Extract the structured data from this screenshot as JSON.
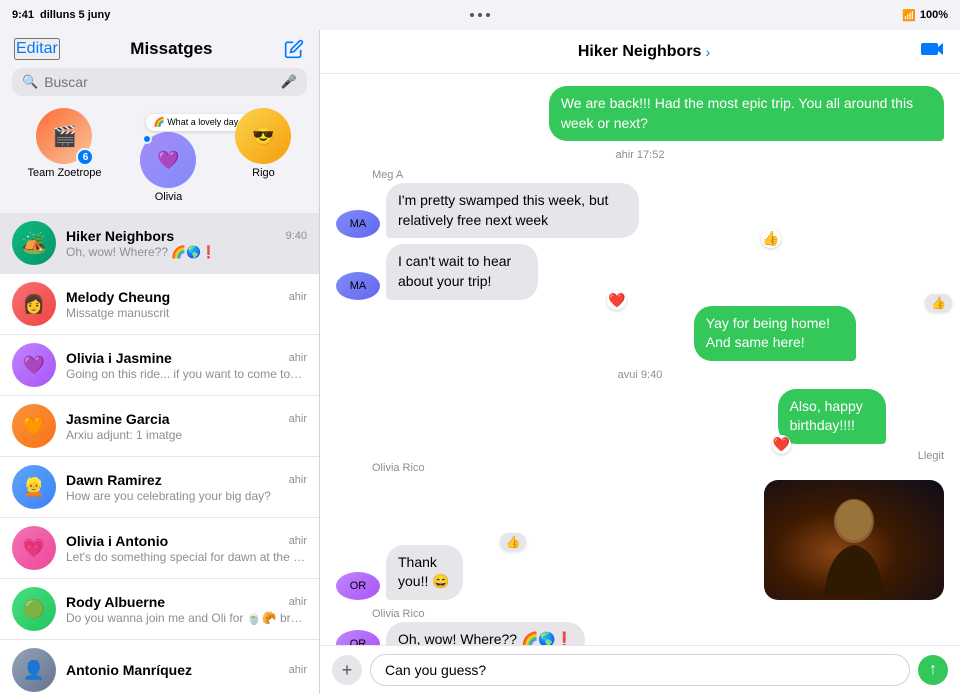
{
  "statusBar": {
    "time": "9:41",
    "date": "dilluns 5 juny",
    "dots": [
      "•",
      "•",
      "•"
    ],
    "wifi": "📶",
    "battery": "100%"
  },
  "leftPanel": {
    "editLabel": "Editar",
    "title": "Missatges",
    "searchPlaceholder": "Buscar",
    "pinnedContacts": [
      {
        "name": "Team Zoetrope",
        "emoji": "🎬",
        "badge": "6",
        "id": "team-zoetrope"
      },
      {
        "name": "Olivia",
        "emoji": "💜",
        "dot": true,
        "id": "olivia",
        "bubbleText": "🌈 What a lovely day, sunshine!"
      },
      {
        "name": "Rigo",
        "emoji": "😎",
        "id": "rigo"
      }
    ],
    "conversations": [
      {
        "name": "Hiker Neighbors",
        "time": "9:40",
        "preview": "Oh, wow! Where?? 🌈🌎❗",
        "emoji": "🏕️",
        "active": true,
        "avatarClass": "av-hiker"
      },
      {
        "name": "Melody Cheung",
        "time": "ahir",
        "preview": "Missatge manuscrit",
        "avatarClass": "av-melody"
      },
      {
        "name": "Olivia i Jasmine",
        "time": "ahir",
        "preview": "Going on this ride... if you want to come too you're welcome",
        "avatarClass": "av-oliviaj"
      },
      {
        "name": "Jasmine Garcia",
        "time": "ahir",
        "preview": "Arxiu adjunt: 1 imatge",
        "avatarClass": "av-jasmine"
      },
      {
        "name": "Dawn Ramirez",
        "time": "ahir",
        "preview": "How are you celebrating your big day?",
        "avatarClass": "av-dawn"
      },
      {
        "name": "Olivia i Antonio",
        "time": "ahir",
        "preview": "Let's do something special for dawn at the next meeting ok?",
        "avatarClass": "av-oliviaa"
      },
      {
        "name": "Rody Albuerne",
        "time": "ahir",
        "preview": "Do you wanna join me and Oli for 🍵🥐 breakfast?",
        "avatarClass": "av-rody"
      },
      {
        "name": "Antonio Manríquez",
        "time": "ahir",
        "preview": "",
        "avatarClass": "av-antonio"
      }
    ]
  },
  "rightPanel": {
    "chatTitle": "Hiker Neighbors",
    "messages": [
      {
        "id": "msg1",
        "side": "right",
        "text": "We are back!!! Had the most epic trip. You all around this week or next?",
        "type": "bubble-green"
      },
      {
        "id": "time1",
        "type": "time",
        "text": "ahir 17:52"
      },
      {
        "id": "sender1",
        "type": "sender",
        "text": "Meg A"
      },
      {
        "id": "msg2",
        "side": "left",
        "text": "I'm pretty swamped this week, but relatively free next week",
        "type": "bubble-gray",
        "reaction": "👍"
      },
      {
        "id": "msg3",
        "side": "left",
        "text": "I can't wait to hear about your trip!",
        "type": "bubble-gray",
        "reaction": "❤️"
      },
      {
        "id": "msg4",
        "side": "right",
        "text": "Yay for being home! And same here!",
        "type": "bubble-green",
        "reaction": "👍"
      },
      {
        "id": "time2",
        "type": "time",
        "text": "avui 9:40"
      },
      {
        "id": "msg5",
        "side": "right",
        "text": "Also, happy birthday!!!!",
        "type": "bubble-green",
        "read": "Llegit"
      },
      {
        "id": "sender2",
        "type": "sender",
        "text": "Olivia Rico"
      },
      {
        "id": "msg6",
        "side": "left",
        "text": "Thank you!! 😄",
        "type": "bubble-gray",
        "reaction": "👍"
      },
      {
        "id": "msg7",
        "side": "right",
        "text": "",
        "type": "image"
      },
      {
        "id": "sender3",
        "type": "sender",
        "text": "Olivia Rico"
      },
      {
        "id": "msg8",
        "side": "left",
        "text": "Oh, wow! Where?? 🌈🌎❗",
        "type": "bubble-gray"
      }
    ],
    "inputPlaceholder": "Can you guess?",
    "plusLabel": "+",
    "sendLabel": "↑"
  }
}
